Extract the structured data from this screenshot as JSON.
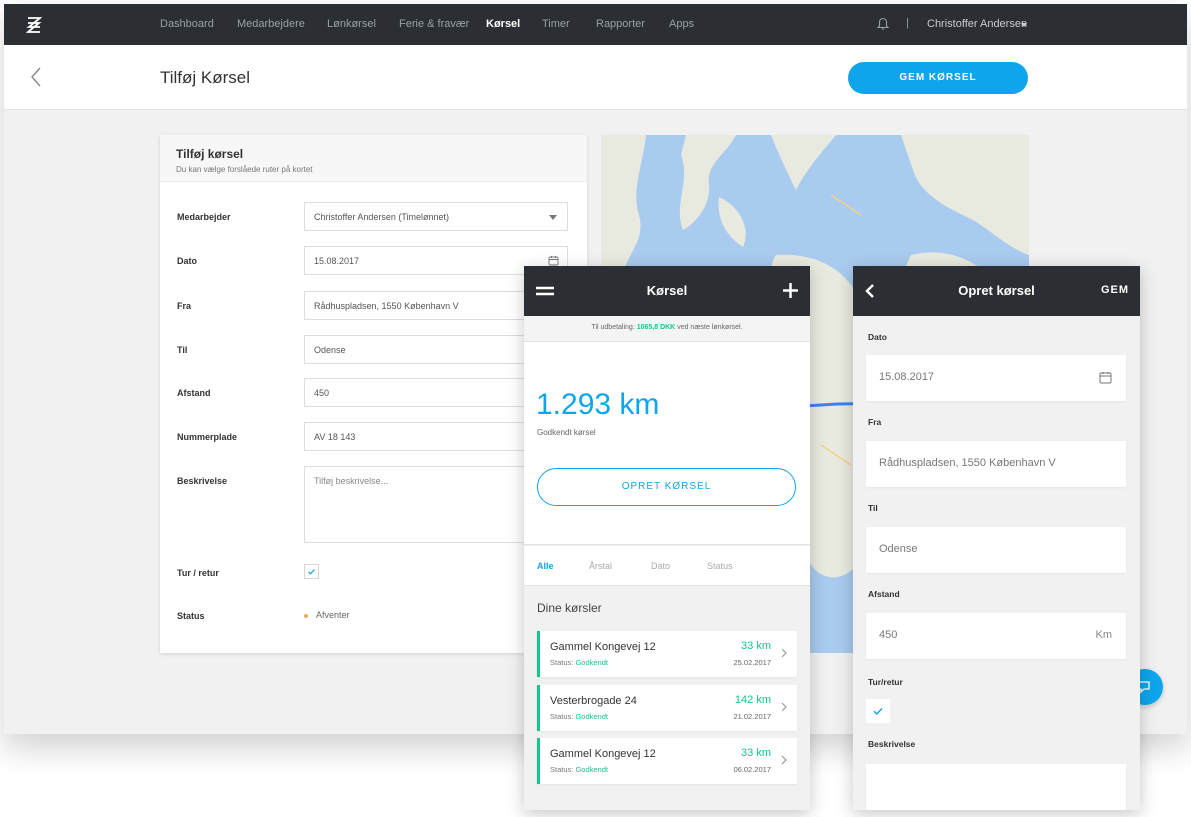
{
  "nav": {
    "items": [
      "Dashboard",
      "Medarbejdere",
      "Lønkørsel",
      "Ferie & fravær",
      "Kørsel",
      "Timer",
      "Rapporter",
      "Apps"
    ],
    "active": "Kørsel",
    "separator": "|",
    "user": "Christoffer Andersen"
  },
  "header": {
    "title": "Tilføj Kørsel",
    "save_label": "GEM KØRSEL"
  },
  "form": {
    "title": "Tilføj kørsel",
    "subtitle": "Du kan vælge forslåede ruter på kortet",
    "employee_label": "Medarbejder",
    "employee_value": "Christoffer Andersen (Timelønnet)",
    "date_label": "Dato",
    "date_value": "15.08.2017",
    "from_label": "Fra",
    "from_value": "Rådhuspladsen, 1550 København V",
    "to_label": "Til",
    "to_value": "Odense",
    "distance_label": "Afstand",
    "distance_value": "450",
    "plate_label": "Nummerplade",
    "plate_value": "AV 18 143",
    "description_label": "Beskrivelse",
    "description_placeholder": "Tilføj beskrivelse...",
    "roundtrip_label": "Tur / retur",
    "roundtrip_checked": true,
    "status_label": "Status",
    "status_value": "Afventer",
    "status_color": "#f0a35a"
  },
  "mobile_list": {
    "title": "Kørsel",
    "info_prefix": "Til udbetaling:",
    "info_amount": "1065,8 DKK",
    "info_suffix": "ved næste lønkørsel.",
    "total_km": "1.293 km",
    "total_label": "Godkendt kørsel",
    "create_label": "OPRET KØRSEL",
    "tabs": [
      "Alle",
      "Årstal",
      "Dato",
      "Status"
    ],
    "active_tab": "Alle",
    "list_title": "Dine kørsler",
    "status_prefix": "Status:",
    "trips": [
      {
        "address": "Gammel Kongevej 12",
        "status": "Godkendt",
        "km": "33 km",
        "date": "25.02.2017"
      },
      {
        "address": "Vesterbrogade 24",
        "status": "Godkendt",
        "km": "142 km",
        "date": "21.02.2017"
      },
      {
        "address": "Gammel Kongevej 12",
        "status": "Godkendt",
        "km": "33 km",
        "date": "06.02.2017"
      }
    ]
  },
  "mobile_create": {
    "title": "Opret kørsel",
    "save_label": "GEM",
    "date_label": "Dato",
    "date_value": "15.08.2017",
    "from_label": "Fra",
    "from_value": "Rådhuspladsen, 1550 København V",
    "to_label": "Til",
    "to_value": "Odense",
    "distance_label": "Afstand",
    "distance_value": "450",
    "distance_unit": "Km",
    "roundtrip_label": "Tur/retur",
    "roundtrip_checked": true,
    "description_label": "Beskrivelse"
  },
  "colors": {
    "accent": "#0ea5ed",
    "success": "#14c58d",
    "nav_bg": "#2b2f33"
  }
}
